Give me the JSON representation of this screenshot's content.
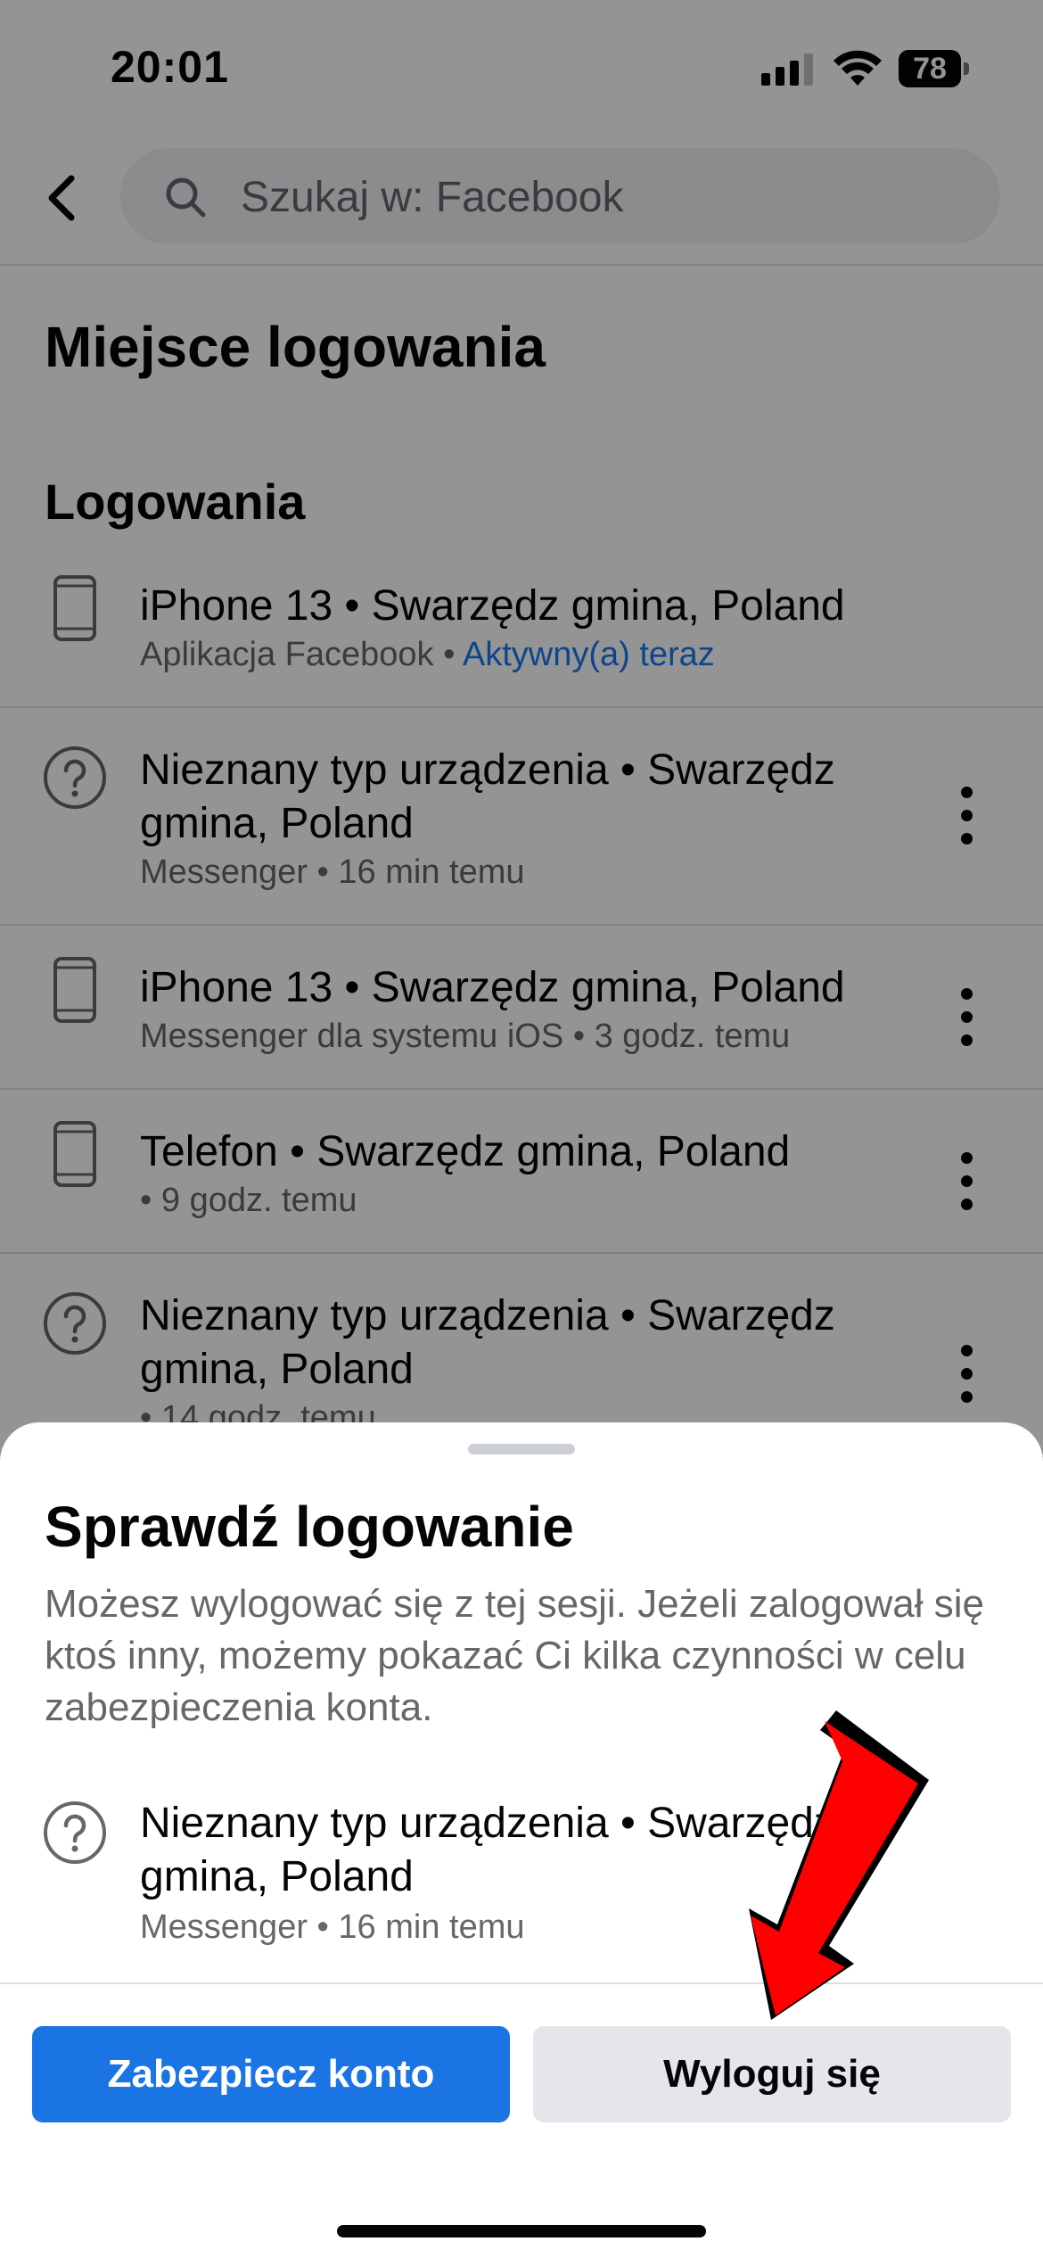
{
  "status_bar": {
    "time": "20:01",
    "battery": "78",
    "icons": [
      "signal-icon",
      "wifi-icon",
      "battery-icon"
    ]
  },
  "top_nav": {
    "back_icon": "chevron-left-icon",
    "search_icon": "search-icon",
    "search_placeholder": "Szukaj w: Facebook"
  },
  "page": {
    "title": "Miejsce logowania",
    "section_heading": "Logowania"
  },
  "sessions": [
    {
      "icon": "phone-icon",
      "title": "iPhone 13 • Swarzędz gmina, Poland",
      "app": "Aplikacja Facebook",
      "separator": " • ",
      "time": "Aktywny(a) teraz",
      "active": true
    },
    {
      "icon": "question-circle-icon",
      "title": "Nieznany typ urządzenia • Swarzędz gmina, Poland",
      "app": "Messenger",
      "separator": " • ",
      "time": "16 min temu"
    },
    {
      "icon": "phone-icon",
      "title": "iPhone 13 • Swarzędz gmina, Poland",
      "app": "Messenger dla systemu iOS",
      "separator": " • ",
      "time": "3 godz. temu"
    },
    {
      "icon": "phone-icon",
      "title": "Telefon • Swarzędz gmina, Poland",
      "app": "",
      "separator": " • ",
      "time": "9 godz. temu"
    },
    {
      "icon": "question-circle-icon",
      "title": "Nieznany typ urządzenia • Swarzędz gmina, Poland",
      "app": "",
      "separator": " • ",
      "time": "14 godz. temu"
    }
  ],
  "sheet": {
    "title": "Sprawdź logowanie",
    "description": "Możesz wylogować się z tej sesji. Jeżeli zalogował się ktoś inny, możemy pokazać Ci kilka czynności w celu zabezpieczenia konta.",
    "session": {
      "icon": "question-circle-icon",
      "title": "Nieznany typ urządzenia • Swarzędz gmina, Poland",
      "subtitle": "Messenger • 16 min temu"
    },
    "primary_button": "Zabezpiecz konto",
    "secondary_button": "Wyloguj się"
  },
  "colors": {
    "accent": "#1b74e4",
    "link": "#1877f2",
    "arrow": "#ff0000"
  }
}
